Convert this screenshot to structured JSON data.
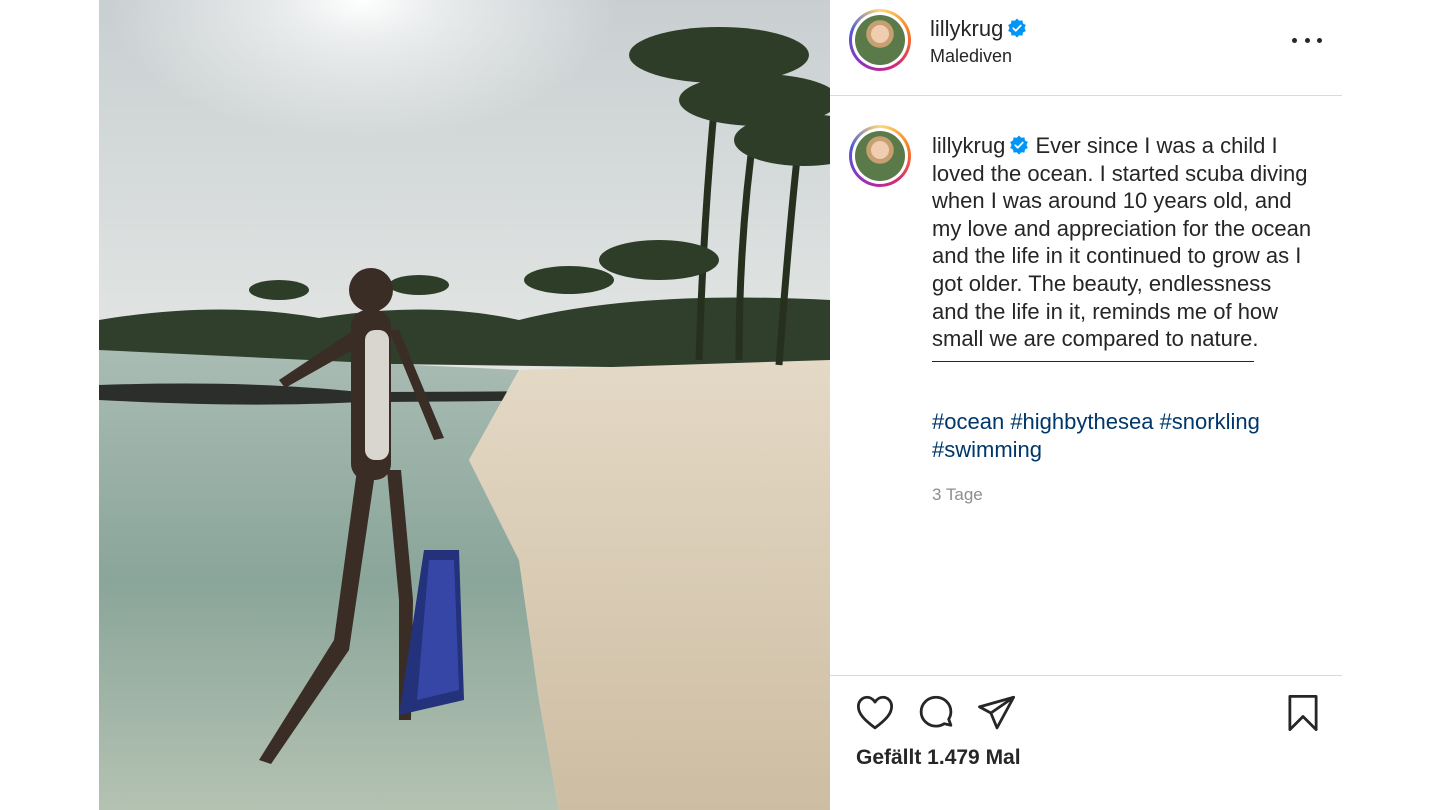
{
  "post": {
    "username": "lillykrug",
    "location": "Malediven",
    "caption_username": "lillykrug",
    "caption_text": "Ever since I was a child I loved the ocean. I started scuba diving when I was around 10 years old, and my love and appreciation for the ocean and the life in it continued to grow as I got older. The beauty, endlessness and the life in it, reminds me of how small we are compared to nature.",
    "hashtags": [
      "#ocean",
      "#highbythesea",
      "#snorkling",
      "#swimming"
    ],
    "time_ago": "3 Tage",
    "likes_text": "Gefällt 1.479 Mal"
  },
  "icons": {
    "verified": "verified-badge-icon",
    "more": "more-options-icon",
    "like": "heart-icon",
    "comment": "comment-bubble-icon",
    "share": "paper-plane-icon",
    "save": "bookmark-icon"
  },
  "colors": {
    "verified_blue": "#0095f6",
    "hashtag": "#00376b",
    "muted": "#8e8e8e",
    "text": "#262626",
    "border": "#dbdbdb"
  }
}
